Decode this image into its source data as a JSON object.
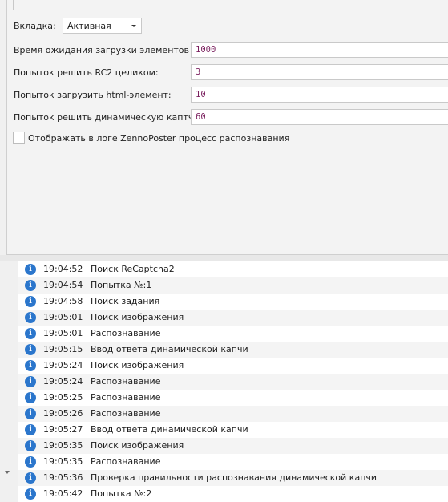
{
  "settings": {
    "tab_label": "Вкладка:",
    "tab_value": "Активная",
    "wait_label": "Время ожидания загрузки элементов (мс):",
    "wait_value": "1000",
    "rc2_label": "Попыток решить RC2 целиком:",
    "rc2_value": "3",
    "html_label": "Попыток загрузить html-элемент:",
    "html_value": "10",
    "dynamic_label": "Попыток решить динамическую каптчу:",
    "dynamic_value": "60",
    "log_checkbox_label": "Отображать в логе ZennoPoster процесс распознавания"
  },
  "log": {
    "entries": [
      {
        "time": "19:04:52",
        "message": "Поиск ReCaptcha2"
      },
      {
        "time": "19:04:54",
        "message": "Попытка №:1"
      },
      {
        "time": "19:04:58",
        "message": "Поиск задания"
      },
      {
        "time": "19:05:01",
        "message": "Поиск изображения"
      },
      {
        "time": "19:05:01",
        "message": "Распознавание"
      },
      {
        "time": "19:05:15",
        "message": "Ввод ответа динамической капчи"
      },
      {
        "time": "19:05:24",
        "message": "Поиск изображения"
      },
      {
        "time": "19:05:24",
        "message": "Распознавание"
      },
      {
        "time": "19:05:25",
        "message": "Распознавание"
      },
      {
        "time": "19:05:26",
        "message": "Распознавание"
      },
      {
        "time": "19:05:27",
        "message": "Ввод ответа динамической капчи"
      },
      {
        "time": "19:05:35",
        "message": "Поиск изображения"
      },
      {
        "time": "19:05:35",
        "message": "Распознавание"
      },
      {
        "time": "19:05:36",
        "message": "Проверка правильности распознавания динамической капчи"
      },
      {
        "time": "19:05:42",
        "message": "Попытка №:2"
      }
    ]
  }
}
